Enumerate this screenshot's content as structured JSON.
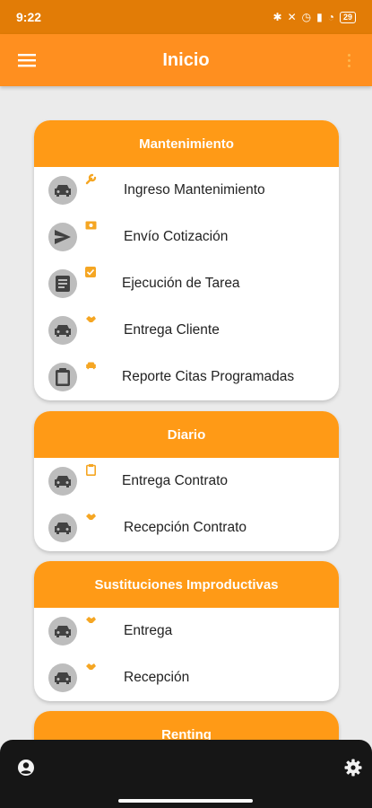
{
  "status_bar": {
    "time": "9:22",
    "battery": "29"
  },
  "app_bar": {
    "title": "Inicio",
    "menu_icon": "hamburger-menu-icon",
    "more_icon": "more-vert-icon"
  },
  "sections": [
    {
      "title": "Mantenimiento",
      "items": [
        {
          "label": "Ingreso Mantenimiento",
          "icon": "car-icon",
          "badge": "wrench-icon"
        },
        {
          "label": "Envío Cotización",
          "icon": "send-icon",
          "badge": "cash-icon"
        },
        {
          "label": "Ejecución de Tarea",
          "icon": "document-icon",
          "badge": "checkbox-icon"
        },
        {
          "label": "Entrega Cliente",
          "icon": "car-icon",
          "badge": "handshake-icon"
        },
        {
          "label": "Reporte Citas Programadas",
          "icon": "clipboard-icon",
          "badge": "car-icon"
        }
      ]
    },
    {
      "title": "Diario",
      "items": [
        {
          "label": "Entrega Contrato",
          "icon": "car-icon",
          "badge": "clipboard-icon"
        },
        {
          "label": "Recepción Contrato",
          "icon": "car-icon",
          "badge": "handshake-icon"
        }
      ]
    },
    {
      "title": "Sustituciones Improductivas",
      "items": [
        {
          "label": "Entrega",
          "icon": "car-icon",
          "badge": "handshake-icon"
        },
        {
          "label": "Recepción",
          "icon": "car-icon",
          "badge": "handshake-icon"
        }
      ]
    },
    {
      "title": "Renting",
      "items": []
    }
  ],
  "bottom_bar": {
    "left_icon": "account-circle-icon",
    "right_icon": "settings-icon"
  },
  "colors": {
    "primary": "#ff8f1f",
    "status_bar": "#e27c06",
    "section_header": "#ff9a16",
    "icon_bg": "#bdbdbd",
    "icon_fg": "#424242",
    "badge": "#f5a623",
    "background": "#ebebeb"
  }
}
